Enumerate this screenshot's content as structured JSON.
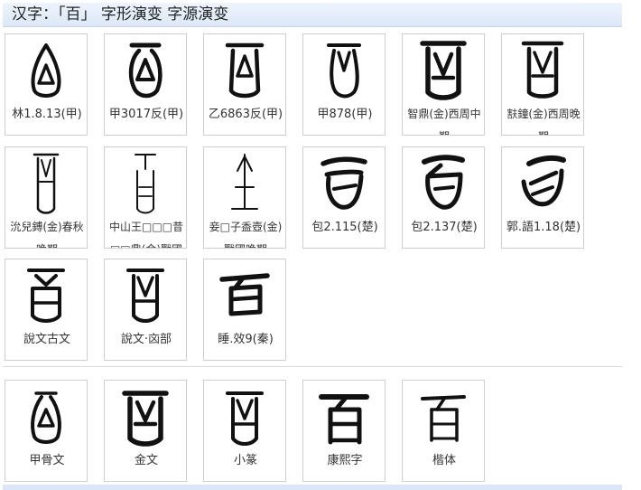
{
  "header": {
    "title": "汉字：「百」 字形演变 字源演变"
  },
  "rows": {
    "row1": [
      {
        "label": "林1.8.13(甲)"
      },
      {
        "label": "甲3017反(甲)"
      },
      {
        "label": "乙6863反(甲)"
      },
      {
        "label": "甲878(甲)"
      },
      {
        "label": "智鼎(金)西周中期"
      },
      {
        "label": "㝬鐘(金)西周晚期"
      }
    ],
    "row2": [
      {
        "label": "沇兒鎛(金)春秋晚期"
      },
      {
        "label": "中山王□□□昔□□鼎(金)戰國"
      },
      {
        "label": "妾□子盉壺(金)戰國晚期"
      },
      {
        "label": "包2.115(楚)"
      },
      {
        "label": "包2.137(楚)"
      },
      {
        "label": "郭.語1.18(楚)"
      }
    ],
    "row3": [
      {
        "label": "說文古文"
      },
      {
        "label": "說文·㐫部"
      },
      {
        "label": "睡.效9(秦)"
      }
    ],
    "row4": [
      {
        "label": "甲骨文"
      },
      {
        "label": "金文"
      },
      {
        "label": "小篆"
      },
      {
        "label": "康熙字"
      },
      {
        "label": "楷体"
      }
    ]
  }
}
